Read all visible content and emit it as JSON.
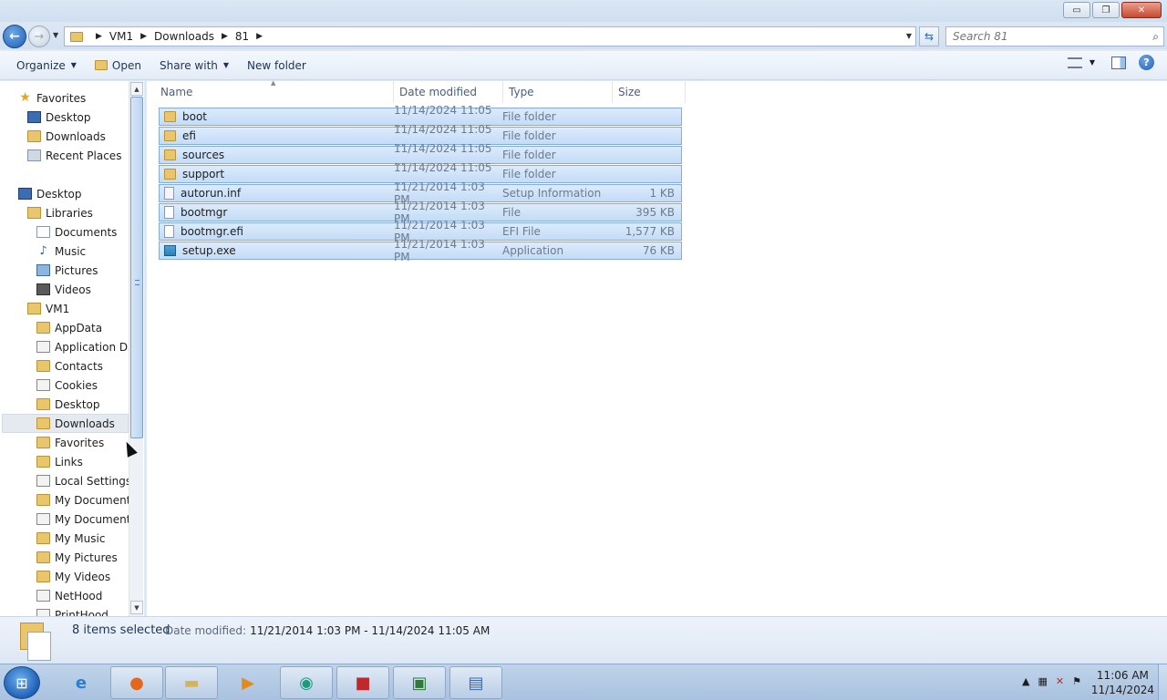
{
  "window": {
    "minimize_label": "▭",
    "maximize_label": "❐",
    "close_label": "✕"
  },
  "address": {
    "crumbs": [
      "VM1",
      "Downloads",
      "81"
    ],
    "search_placeholder": "Search 81"
  },
  "toolbar": {
    "organize": "Organize",
    "open": "Open",
    "share_with": "Share with",
    "new_folder": "New folder"
  },
  "nav": {
    "favorites": "Favorites",
    "desktop_fav": "Desktop",
    "downloads_fav": "Downloads",
    "recent_places": "Recent Places",
    "desktop": "Desktop",
    "libraries": "Libraries",
    "documents": "Documents",
    "music": "Music",
    "pictures": "Pictures",
    "videos": "Videos",
    "vm1": "VM1",
    "appdata": "AppData",
    "application_data": "Application Data",
    "contacts": "Contacts",
    "cookies": "Cookies",
    "desktop_user": "Desktop",
    "downloads_user": "Downloads",
    "favorites_user": "Favorites",
    "links": "Links",
    "local_settings": "Local Settings",
    "my_documents_1": "My Documents",
    "my_documents_2": "My Documents",
    "my_music": "My Music",
    "my_pictures": "My Pictures",
    "my_videos": "My Videos",
    "nethood": "NetHood",
    "printhood": "PrintHood"
  },
  "columns": {
    "name": "Name",
    "date_modified": "Date modified",
    "type": "Type",
    "size": "Size"
  },
  "files": [
    {
      "name": "boot",
      "date": "11/14/2024 11:05 ...",
      "type": "File folder",
      "size": "",
      "icon": "folder"
    },
    {
      "name": "efi",
      "date": "11/14/2024 11:05 ...",
      "type": "File folder",
      "size": "",
      "icon": "folder"
    },
    {
      "name": "sources",
      "date": "11/14/2024 11:05 ...",
      "type": "File folder",
      "size": "",
      "icon": "folder"
    },
    {
      "name": "support",
      "date": "11/14/2024 11:05 ...",
      "type": "File folder",
      "size": "",
      "icon": "folder"
    },
    {
      "name": "autorun.inf",
      "date": "11/21/2014 1:03 PM",
      "type": "Setup Information",
      "size": "1 KB",
      "icon": "settings"
    },
    {
      "name": "bootmgr",
      "date": "11/21/2014 1:03 PM",
      "type": "File",
      "size": "395 KB",
      "icon": "file"
    },
    {
      "name": "bootmgr.efi",
      "date": "11/21/2014 1:03 PM",
      "type": "EFI File",
      "size": "1,577 KB",
      "icon": "file"
    },
    {
      "name": "setup.exe",
      "date": "11/21/2014 1:03 PM",
      "type": "Application",
      "size": "76 KB",
      "icon": "app"
    }
  ],
  "details": {
    "count": "8 items selected",
    "date_label": "Date modified:",
    "date_value": "11/21/2014 1:03 PM - 11/14/2024 11:05 AM"
  },
  "taskbar": {
    "time": "11:06 AM",
    "date": "11/14/2024"
  }
}
